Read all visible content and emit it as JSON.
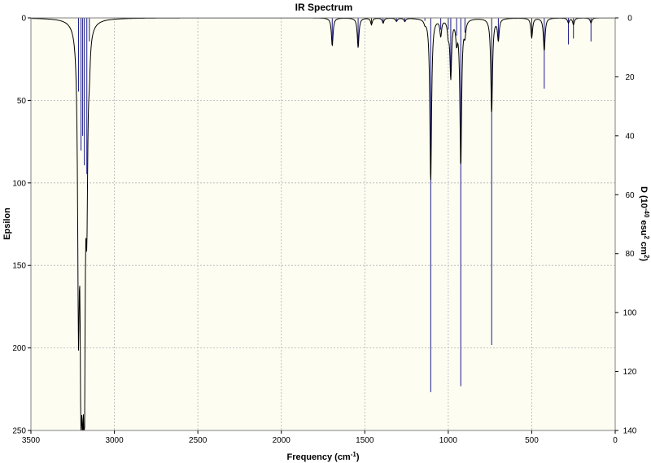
{
  "chart_data": {
    "type": "line",
    "title": "IR Spectrum",
    "xlabel": {
      "main": "Frequency (cm",
      "sup": "-1",
      "close": ")"
    },
    "ylabel": "Epsilon",
    "y2label": {
      "p1": "D (10",
      "sup1": "-40",
      "p2": " esu",
      "sup2": "2",
      "p3": " cm",
      "sup3": "2",
      "p4": ")"
    },
    "xlim": [
      3500,
      0
    ],
    "ylim": [
      0,
      250
    ],
    "y2lim": [
      0,
      140
    ],
    "x_ticks": [
      3500,
      3000,
      2500,
      2000,
      1500,
      1000,
      500,
      0
    ],
    "y_ticks": [
      0,
      50,
      100,
      150,
      200,
      250
    ],
    "y2_ticks": [
      0,
      20,
      40,
      60,
      80,
      100,
      120,
      140
    ],
    "grid": true,
    "y_inverted": true,
    "colors": {
      "spectrum": "#000000",
      "stick": "#1a1a8c",
      "plot_bg": "#fdfdf2",
      "grid": "#b4b4b4",
      "frame": "#808080"
    },
    "spectrum_width": 6,
    "peaks": [
      {
        "x": 3215,
        "eps": 160,
        "d": 25
      },
      {
        "x": 3200,
        "eps": 190,
        "d": 45
      },
      {
        "x": 3190,
        "eps": 140,
        "d": 40
      },
      {
        "x": 3180,
        "eps": 200,
        "d": 50
      },
      {
        "x": 3165,
        "eps": 95,
        "d": 53
      },
      {
        "x": 3150,
        "eps": 15,
        "d": 8
      },
      {
        "x": 1695,
        "eps": 17,
        "d": 9
      },
      {
        "x": 1540,
        "eps": 18,
        "d": 10
      },
      {
        "x": 1460,
        "eps": 4,
        "d": 2
      },
      {
        "x": 1390,
        "eps": 3,
        "d": 2
      },
      {
        "x": 1310,
        "eps": 2,
        "d": 1
      },
      {
        "x": 1260,
        "eps": 2,
        "d": 1
      },
      {
        "x": 1140,
        "eps": 2,
        "d": 1
      },
      {
        "x": 1105,
        "eps": 100,
        "d": 127
      },
      {
        "x": 1045,
        "eps": 10,
        "d": 4
      },
      {
        "x": 1000,
        "eps": 8,
        "d": 4
      },
      {
        "x": 985,
        "eps": 35,
        "d": 20
      },
      {
        "x": 950,
        "eps": 12,
        "d": 6
      },
      {
        "x": 925,
        "eps": 90,
        "d": 125
      },
      {
        "x": 900,
        "eps": 8,
        "d": 5
      },
      {
        "x": 740,
        "eps": 58,
        "d": 111
      },
      {
        "x": 700,
        "eps": 13,
        "d": 8
      },
      {
        "x": 500,
        "eps": 12,
        "d": 7
      },
      {
        "x": 425,
        "eps": 20,
        "d": 24
      },
      {
        "x": 280,
        "eps": 3,
        "d": 9
      },
      {
        "x": 250,
        "eps": 4,
        "d": 7
      },
      {
        "x": 145,
        "eps": 3,
        "d": 8
      }
    ]
  }
}
